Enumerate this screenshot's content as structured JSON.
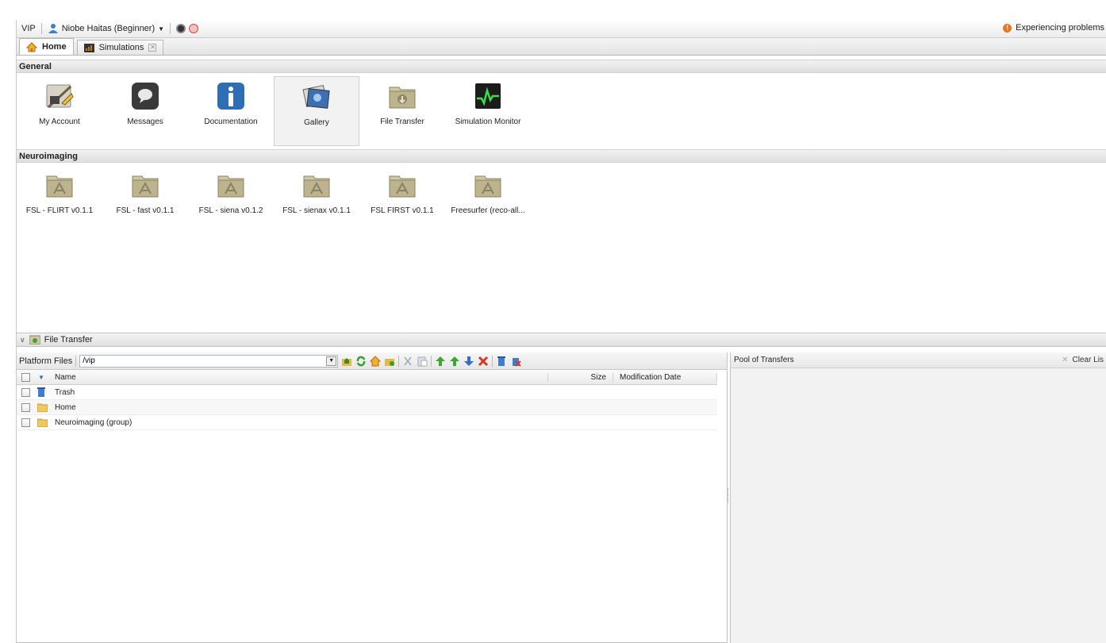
{
  "topbar": {
    "app_name": "VIP",
    "user": "Niobe Haitas (Beginner)",
    "problem_text": "Experiencing problems"
  },
  "tabs": [
    {
      "label": "Home"
    },
    {
      "label": "Simulations"
    }
  ],
  "general": {
    "title": "General",
    "apps": [
      {
        "label": "My Account",
        "icon": "account-icon"
      },
      {
        "label": "Messages",
        "icon": "messages-icon"
      },
      {
        "label": "Documentation",
        "icon": "info-icon"
      },
      {
        "label": "Gallery",
        "icon": "gallery-icon"
      },
      {
        "label": "File Transfer",
        "icon": "file-transfer-icon"
      },
      {
        "label": "Simulation Monitor",
        "icon": "monitor-icon"
      }
    ]
  },
  "neuro": {
    "title": "Neuroimaging",
    "apps": [
      {
        "label": "FSL - FLIRT v0.1.1"
      },
      {
        "label": "FSL - fast v0.1.1"
      },
      {
        "label": "FSL - siena v0.1.2"
      },
      {
        "label": "FSL - sienax v0.1.1"
      },
      {
        "label": "FSL FIRST v0.1.1"
      },
      {
        "label": "Freesurfer (reco-all..."
      }
    ]
  },
  "file_transfer": {
    "title": "File Transfer",
    "platform_label": "Platform Files",
    "path": "/vip",
    "columns": {
      "name": "Name",
      "size": "Size",
      "date": "Modification Date"
    },
    "rows": [
      {
        "name": "Trash",
        "icon": "trash-icon"
      },
      {
        "name": "Home",
        "icon": "folder-icon"
      },
      {
        "name": "Neuroimaging (group)",
        "icon": "folder-icon"
      }
    ],
    "pool_title": "Pool of Transfers",
    "clear_label": "Clear Lis"
  },
  "colors": {
    "accent": "#2a6fbf",
    "warning": "#e8771f",
    "border": "#c3c3c3"
  }
}
